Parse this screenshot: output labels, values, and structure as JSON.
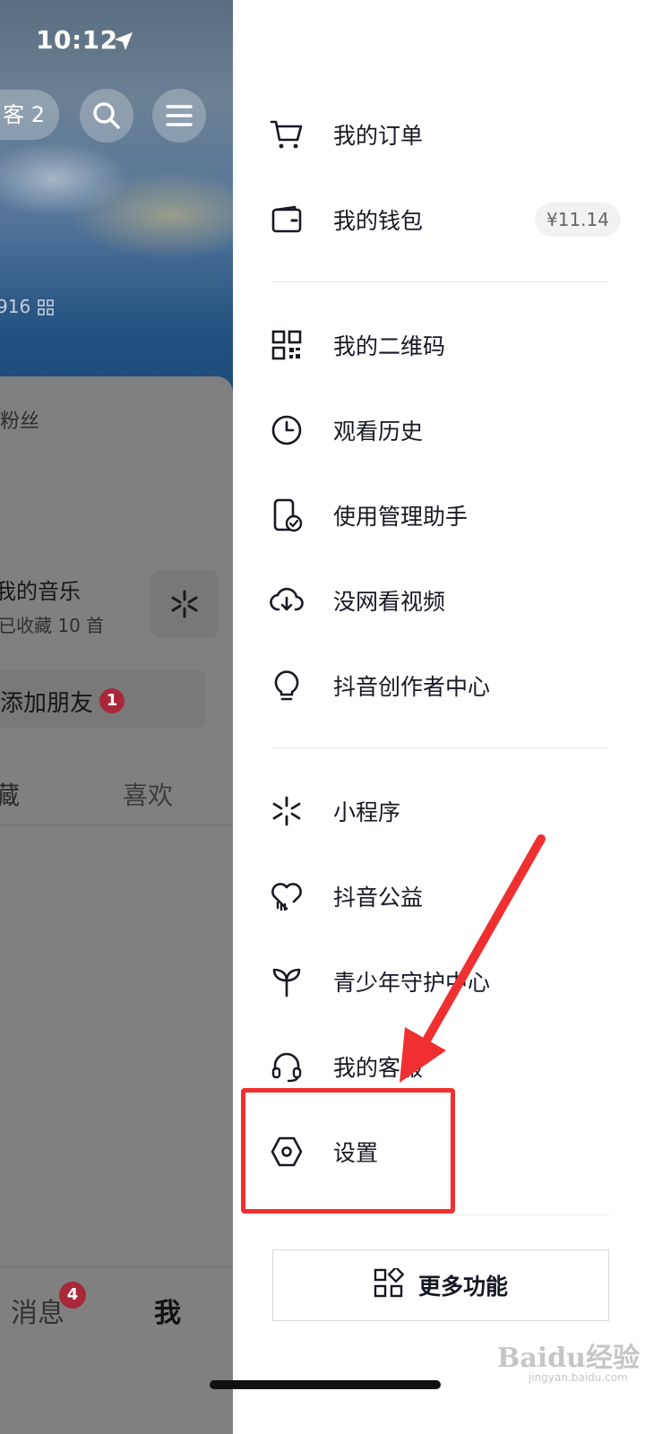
{
  "status_bar": {
    "time": "10:12"
  },
  "profile_background": {
    "visitor_pill": "客 2",
    "uid_fragment": "916",
    "fans_label": "粉丝",
    "music": {
      "title": "我的音乐",
      "subtitle": "已收藏 10 首"
    },
    "add_friend": {
      "label": "添加朋友",
      "badge": "1"
    },
    "tabs": [
      "藏",
      "喜欢"
    ],
    "bottom_nav": {
      "messages": "消息",
      "messages_badge": "4",
      "me": "我"
    }
  },
  "drawer": {
    "items": [
      {
        "label": "我的订单",
        "icon": "cart-icon"
      },
      {
        "label": "我的钱包",
        "icon": "wallet-icon",
        "badge": "¥11.14"
      },
      {
        "label": "我的二维码",
        "icon": "qrcode-icon"
      },
      {
        "label": "观看历史",
        "icon": "clock-icon"
      },
      {
        "label": "使用管理助手",
        "icon": "phone-check-icon"
      },
      {
        "label": "没网看视频",
        "icon": "cloud-download-icon"
      },
      {
        "label": "抖音创作者中心",
        "icon": "lightbulb-icon"
      },
      {
        "label": "小程序",
        "icon": "sparkle-icon"
      },
      {
        "label": "抖音公益",
        "icon": "heart-icon"
      },
      {
        "label": "青少年守护中心",
        "icon": "sprout-icon"
      },
      {
        "label": "我的客服",
        "icon": "headset-icon"
      },
      {
        "label": "设置",
        "icon": "hexagon-settings-icon"
      }
    ],
    "more_button": "更多功能"
  },
  "annotation": {
    "highlight_color": "#f03030"
  },
  "watermark": {
    "text": "Baidu经验",
    "sub": "jingyan.baidu.com"
  }
}
